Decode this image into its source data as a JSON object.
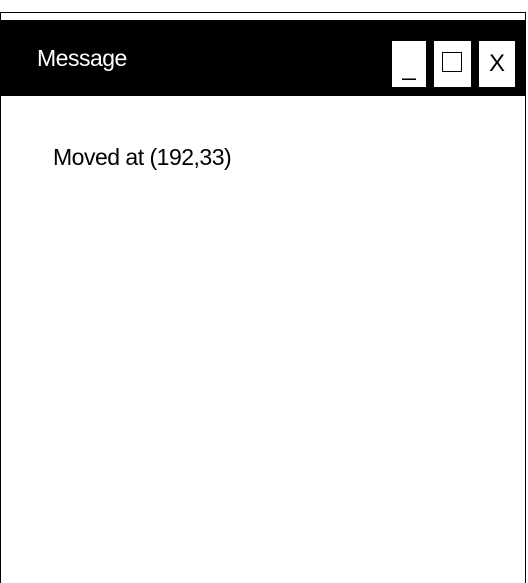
{
  "window": {
    "title": "Message",
    "buttons": {
      "minimize_label": "_",
      "maximize_icon": "maximize-square-icon",
      "close_label": "X"
    }
  },
  "content": {
    "message": "Moved at (192,33)"
  },
  "colors": {
    "titlebar_bg": "#000000",
    "titlebar_text": "#ffffff",
    "window_bg": "#ffffff"
  }
}
